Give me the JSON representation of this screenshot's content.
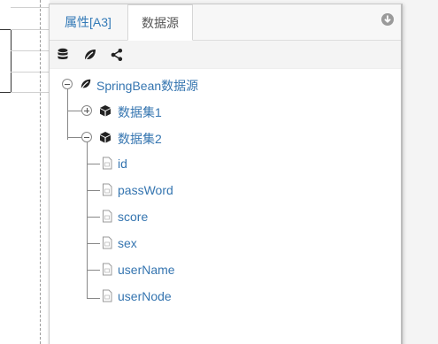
{
  "tabs": [
    {
      "label": "属性[A3]",
      "active": false
    },
    {
      "label": "数据源",
      "active": true
    }
  ],
  "toolbar": {
    "icons": [
      "database-icon",
      "spring-leaf-icon",
      "share-icon"
    ]
  },
  "tree": {
    "root": {
      "label": "SpringBean数据源",
      "expanded": true,
      "icon": "spring-leaf-icon"
    },
    "datasets": [
      {
        "label": "数据集1",
        "expanded": false,
        "icon": "cube-icon"
      },
      {
        "label": "数据集2",
        "expanded": true,
        "icon": "cube-icon"
      }
    ],
    "fields": [
      "id",
      "passWord",
      "score",
      "sex",
      "userName",
      "userNode"
    ]
  },
  "colors": {
    "link": "#3575b0",
    "tree_line": "#888888",
    "panel_border": "#c9c9c9"
  }
}
